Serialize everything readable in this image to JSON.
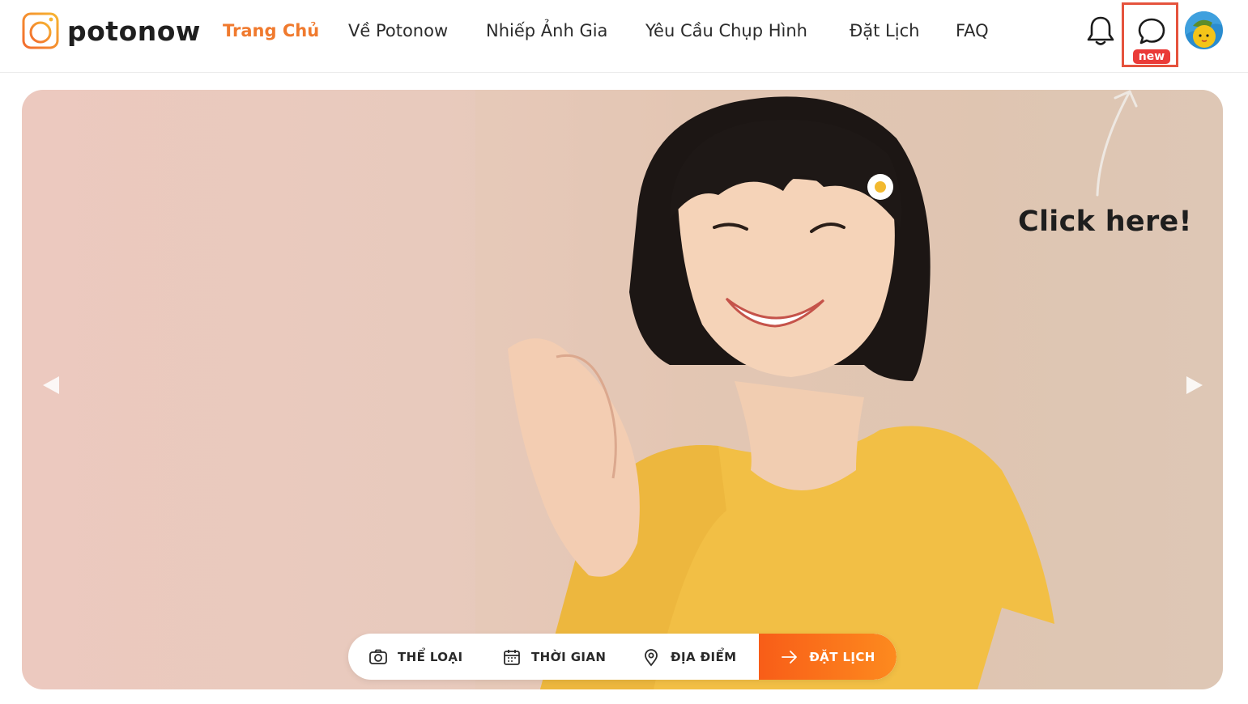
{
  "brand": {
    "name": "potonow",
    "accent": "#f07a2e"
  },
  "nav": {
    "items": [
      {
        "label": "Trang Chủ",
        "active": true
      },
      {
        "label": "Về Potonow",
        "active": false
      },
      {
        "label": "Nhiếp Ảnh Gia",
        "active": false
      },
      {
        "label": "Yêu Cầu Chụp Hình",
        "active": false
      },
      {
        "label": "Đặt Lịch",
        "active": false
      },
      {
        "label": "FAQ",
        "active": false
      }
    ]
  },
  "header_actions": {
    "notification_icon": "bell-icon",
    "chat_icon": "chat-bubble-icon",
    "chat_badge": "new",
    "highlight_color": "#e5533d"
  },
  "hero": {
    "annotation": "Click here!",
    "prev_icon": "triangle-left-icon",
    "next_icon": "triangle-right-icon"
  },
  "search_bar": {
    "category_label": "THỂ LOẠI",
    "time_label": "THỜI GIAN",
    "location_label": "ĐỊA ĐIỂM",
    "book_label": "ĐẶT LỊCH",
    "cta_colors": [
      "#f85d18",
      "#fd8a1e"
    ]
  }
}
